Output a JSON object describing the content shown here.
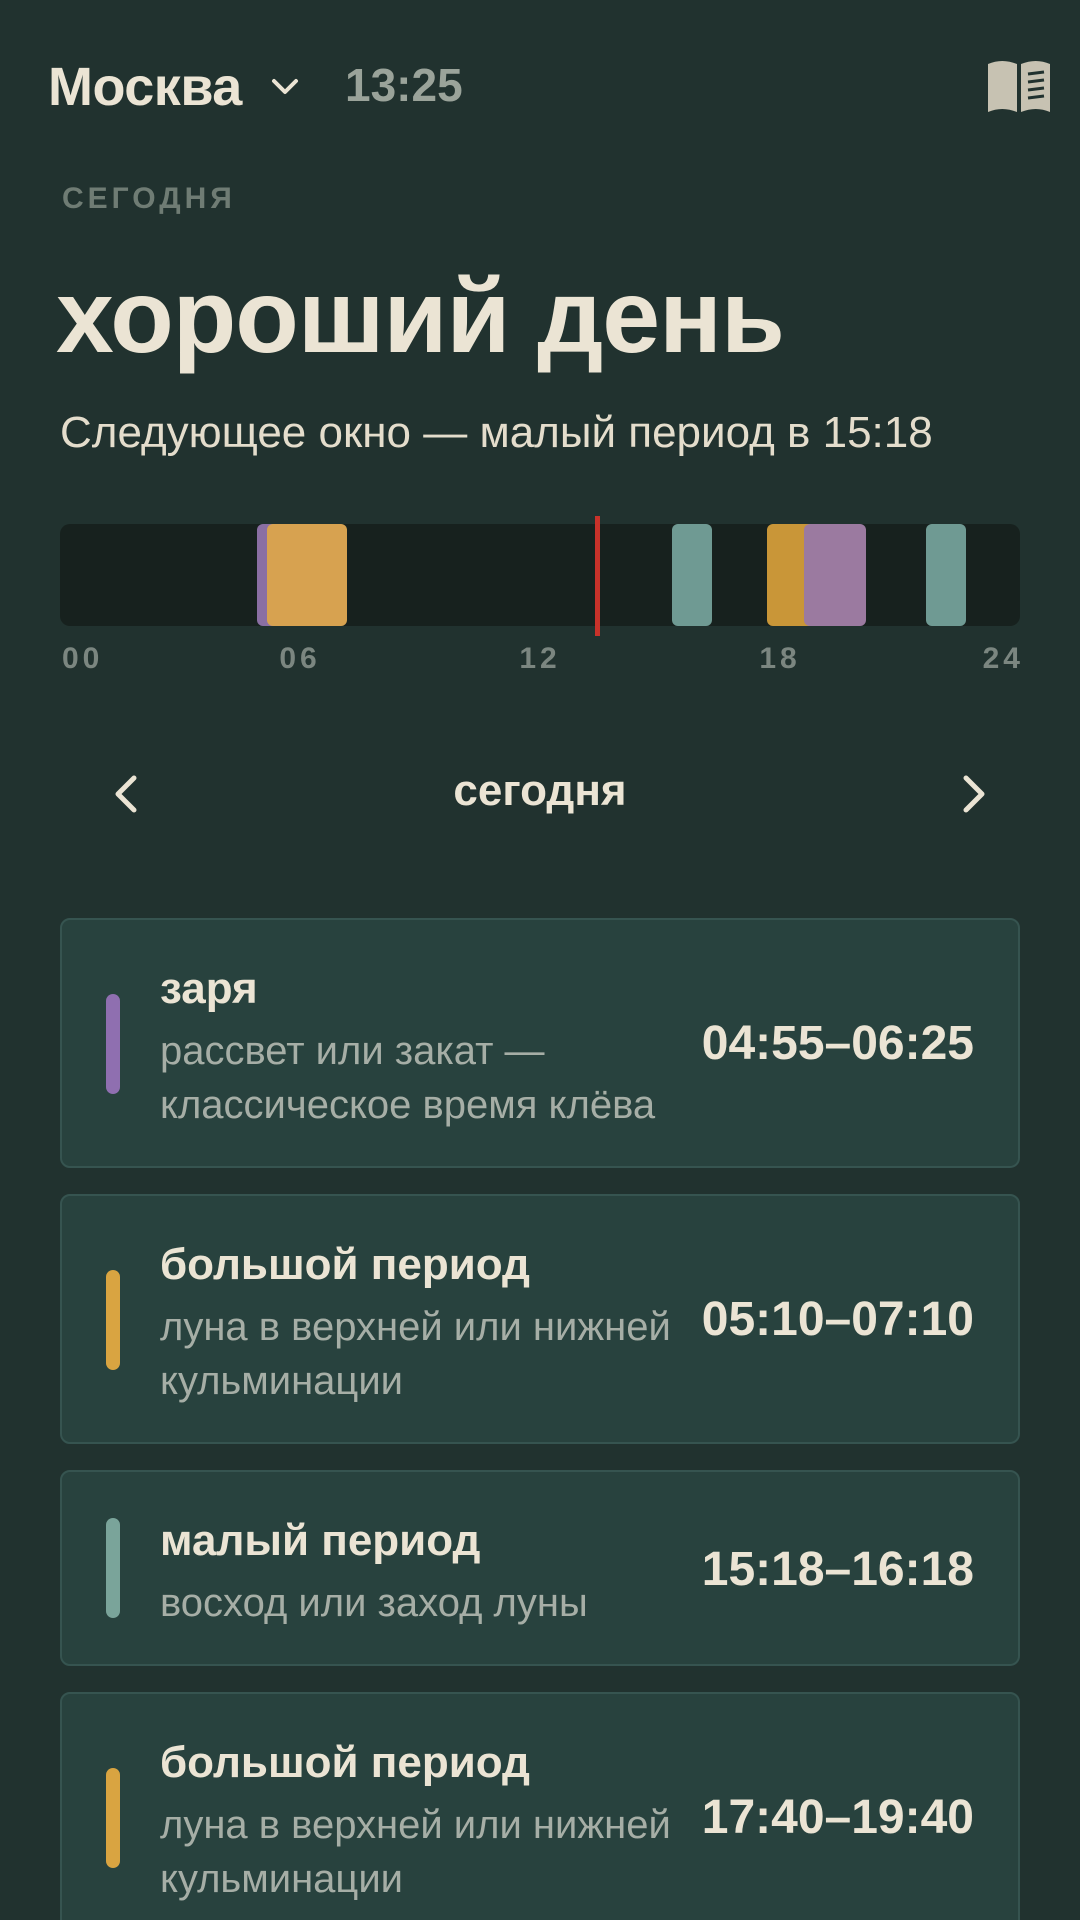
{
  "header": {
    "city": "Москва",
    "time": "13:25"
  },
  "section_label": "СЕГОДНЯ",
  "verdict": "хороший день",
  "next_window": "Следующее окно — малый период в 15:18",
  "timeline": {
    "ticks": [
      "00",
      "06",
      "12",
      "18",
      "24"
    ],
    "now_hour": 13.42,
    "segments": [
      {
        "start": 4.92,
        "end": 6.42,
        "kind": "dawn",
        "color": "#8a6fa3"
      },
      {
        "start": 5.17,
        "end": 7.17,
        "kind": "major",
        "color": "#d7a250"
      },
      {
        "start": 15.3,
        "end": 16.3,
        "kind": "minor",
        "color": "#6f9a93"
      },
      {
        "start": 17.67,
        "end": 19.67,
        "kind": "major",
        "color": "#c99638"
      },
      {
        "start": 18.6,
        "end": 20.15,
        "kind": "dusk",
        "color": "#9b7aa0"
      },
      {
        "start": 21.65,
        "end": 22.65,
        "kind": "minor",
        "color": "#6f9a93"
      }
    ]
  },
  "day_nav": {
    "label": "сегодня"
  },
  "colors": {
    "dawn": "#8f6fb0",
    "major": "#d9a441",
    "minor": "#7aa49a"
  },
  "cards": [
    {
      "title": "заря",
      "desc": "рассвет или закат — классическое время клёва",
      "range": "04:55–06:25",
      "kind": "dawn"
    },
    {
      "title": "большой период",
      "desc": "луна в верхней или нижней кульминации",
      "range": "05:10–07:10",
      "kind": "major"
    },
    {
      "title": "малый период",
      "desc": "восход или заход луны",
      "range": "15:18–16:18",
      "kind": "minor"
    },
    {
      "title": "большой период",
      "desc": "луна в верхней или нижней кульминации",
      "range": "17:40–19:40",
      "kind": "major"
    }
  ]
}
